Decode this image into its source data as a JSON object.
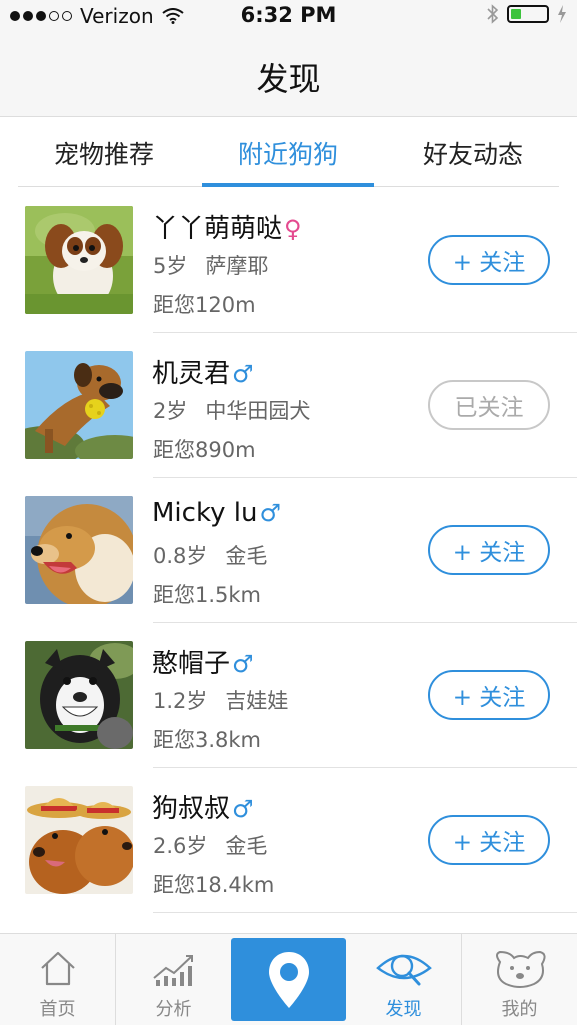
{
  "status_bar": {
    "carrier": "Verizon",
    "time": "6:32 PM",
    "battery_level": 0.3
  },
  "nav": {
    "title": "发现"
  },
  "tabs": [
    {
      "label": "宠物推荐",
      "active": false
    },
    {
      "label": "附近狗狗",
      "active": true
    },
    {
      "label": "好友动态",
      "active": false
    }
  ],
  "pets": [
    {
      "name": "丫丫萌萌哒",
      "sex_symbol": "♀",
      "sex": "female",
      "age": "5岁",
      "breed": "萨摩耶",
      "distance": "距您120m",
      "button": "+ 关注",
      "followed": false
    },
    {
      "name": "机灵君",
      "sex_symbol": "♂",
      "sex": "male",
      "age": "2岁",
      "breed": "中华田园犬",
      "distance": "距您890m",
      "button": "已关注",
      "followed": true
    },
    {
      "name": "Micky lu",
      "sex_symbol": "♂",
      "sex": "male",
      "age": "0.8岁",
      "breed": "金毛",
      "distance": "距您1.5km",
      "button": "+ 关注",
      "followed": false
    },
    {
      "name": "憨帽子",
      "sex_symbol": "♂",
      "sex": "male",
      "age": "1.2岁",
      "breed": "吉娃娃",
      "distance": "距您3.8km",
      "button": "+ 关注",
      "followed": false
    },
    {
      "name": "狗叔叔",
      "sex_symbol": "♂",
      "sex": "male",
      "age": "2.6岁",
      "breed": "金毛",
      "distance": "距您18.4km",
      "button": "+ 关注",
      "followed": false
    }
  ],
  "tabbar": {
    "items": [
      {
        "label": "首页",
        "icon": "home-icon"
      },
      {
        "label": "分析",
        "icon": "chart-icon"
      },
      {
        "label": "",
        "icon": "location-pin-icon"
      },
      {
        "label": "发现",
        "icon": "eye-icon"
      },
      {
        "label": "我的",
        "icon": "dog-face-icon"
      }
    ]
  },
  "colors": {
    "accent": "#2f8fdc",
    "female": "#e44a8f",
    "followed_border": "#c8c8c8"
  }
}
